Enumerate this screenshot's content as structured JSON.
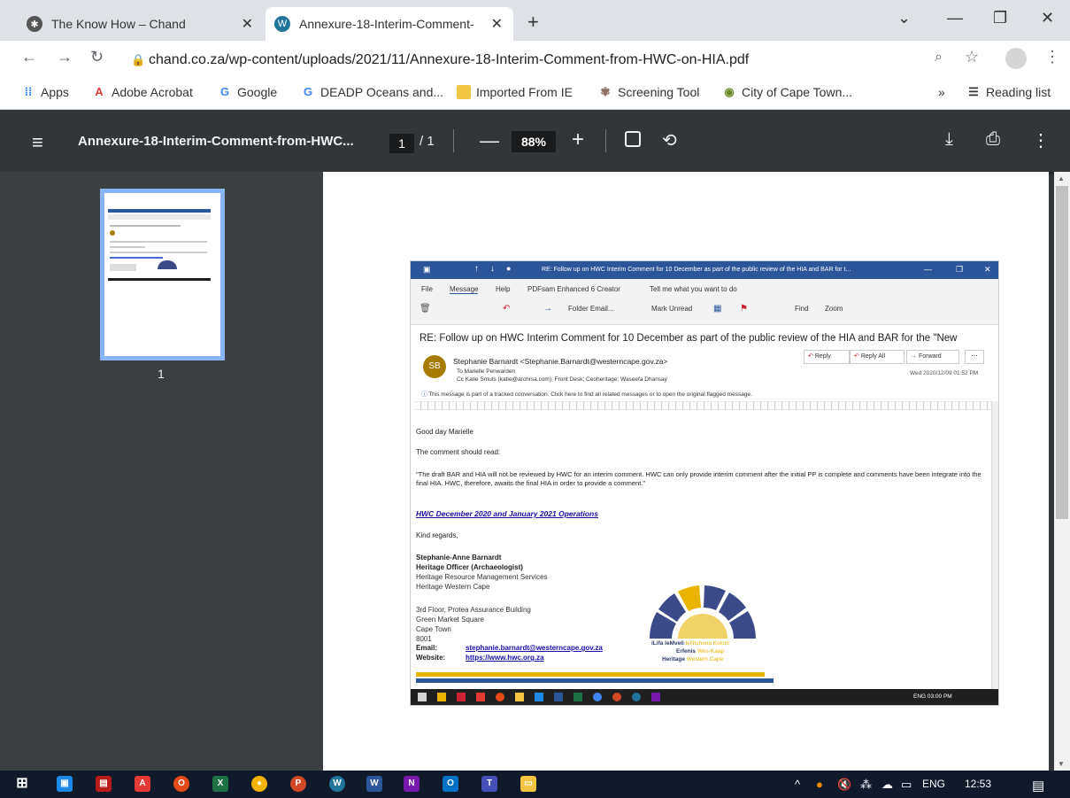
{
  "browser": {
    "tabs": [
      {
        "title": "The Know How – Chand",
        "active": false
      },
      {
        "title": "Annexure-18-Interim-Comment-",
        "active": true
      }
    ],
    "url": "chand.co.za/wp-content/uploads/2021/11/Annexure-18-Interim-Comment-from-HWC-on-HIA.pdf",
    "bookmarks": [
      "Apps",
      "Adobe Acrobat",
      "Google",
      "DEADP Oceans and...",
      "Imported From IE",
      "Screening Tool",
      "City of Cape Town..."
    ],
    "reading_list": "Reading list",
    "more_bookmarks": "»"
  },
  "pdf": {
    "title": "Annexure-18-Interim-Comment-from-HWC...",
    "page_current": "1",
    "page_total": "/ 1",
    "zoom": "88%",
    "thumb_label": "1"
  },
  "email": {
    "window_title": "RE: Follow up on HWC Interim Comment for 10 December as part of the public review of the HIA and BAR for t...",
    "menu": [
      "File",
      "Message",
      "Help",
      "PDFsam Enhanced 6 Creator",
      "Tell me what you want to do"
    ],
    "ribbon": [
      "Folder Email...",
      "Mark Unread",
      "Find",
      "Zoom"
    ],
    "subject": "RE: Follow up on HWC Interim Comment for 10 December as part of the public review of the HIA and BAR for the \"New",
    "avatar": "SB",
    "sender": "Stephanie Barnardt <Stephanie.Barnardt@westerncape.gov.za>",
    "to": "To  Marielle Penwarden",
    "cc": "Cc  Katie Smuts (katie@archrsa.com);  Front Desk;  Ceoheritage;  Waseefa Dhansay",
    "reply": "Reply",
    "reply_all": "Reply All",
    "forward": "Forward",
    "date": "Wed 2020/12/09 01:52 PM",
    "tracked": "This message is part of a tracked conversation. Click here to find all related messages or to open the original flagged message.",
    "greeting": "Good day Marielle",
    "intro": "The comment should read:",
    "quote": "\"The draft BAR and HIA will not be reviewed by HWC for an interim comment. HWC can only provide interim comment after the initial PP is complete and comments have been integrate into the final HIA. HWC, therefore, awaits the final HIA in order to provide a comment.\"",
    "link": "HWC December 2020 and January 2021 Operations",
    "regards": "Kind regards,",
    "sig_name": "Stephanie-Anne Barnardt",
    "sig_title": "Heritage Officer (Archaeologist)",
    "sig_dept": "Heritage Resource Management Services",
    "sig_org": "Heritage Western Cape",
    "addr1": "3rd Floor, Protea Assurance Building",
    "addr2": "Green Market Square",
    "addr3": "Cape Town",
    "addr4": "8001",
    "email_label": "Email:",
    "email_val": "stephanie.barnardt@westerncape.gov.za",
    "web_label": "Website:",
    "web_val": "https://www.hwc.org.za",
    "logo_l1a": "iLifa leMveli",
    "logo_l1b": "leNtshona Koloni",
    "logo_l2a": "Erfenis",
    "logo_l2b": "Wes-Kaap",
    "logo_l3a": "Heritage",
    "logo_l3b": "Western Cape",
    "inner_tray": "ENG  03:00 PM"
  },
  "taskbar": {
    "lang": "ENG",
    "time": "12:53"
  },
  "colors": {
    "outlook_blue": "#2b579a",
    "pdf_toolbar": "#323639",
    "link_blue": "#1a0dab",
    "accent": "#8ab4f8"
  }
}
